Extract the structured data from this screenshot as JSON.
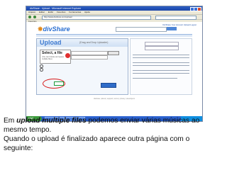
{
  "browser": {
    "title": "divShare - Upload - Microsoft Internet Explorer",
    "menu": [
      "Arquivo",
      "Editar",
      "Exibir",
      "Favoritos",
      "Ferramentas",
      "Ajuda"
    ],
    "address": "http://www.divshare.com/upload",
    "favorites": "Favoritos"
  },
  "site": {
    "logo_prefix": "div",
    "logo_suffix": "Share",
    "user_links": "DivShare  Your Account  Upload  Logout",
    "upload_title": "Upload",
    "upload_subtitle": "(Drag and Drop Uploader)",
    "select_label": "Select, a file",
    "select_note": "(You can browse and queue multiple files)",
    "footer": "divshare  |  about  |  support  |  terms  |  privacy  |  developers"
  },
  "caption": {
    "prefix": "Em ",
    "emphasis": "upload multiple files",
    "line1_rest": " podemos enviar  várias músicas ao",
    "line2": "mesmo tempo.",
    "line3": "Quando o upload é finalizado aparece outra página com o",
    "line4": "seguinte:"
  },
  "colors": {
    "accent": "#2a6fd1",
    "highlight_circle": "#d71b1b",
    "taskbar": "#245edb"
  }
}
